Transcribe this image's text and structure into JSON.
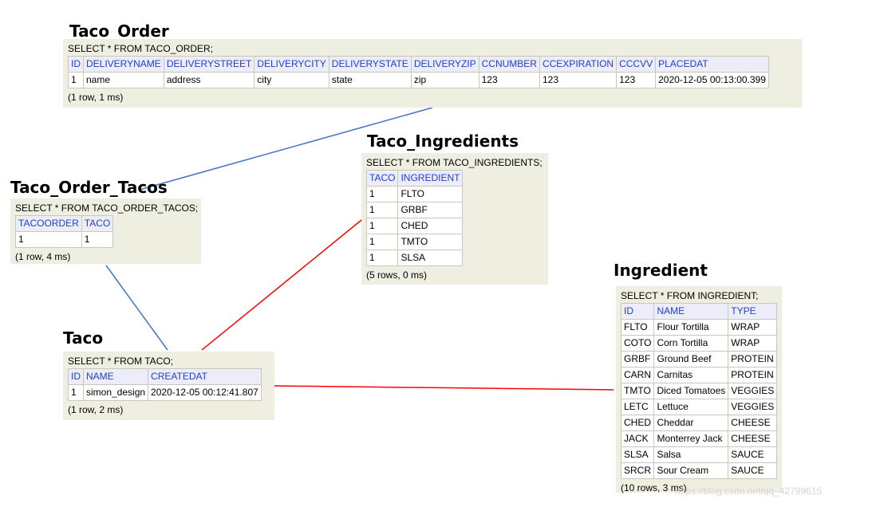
{
  "panels": {
    "taco_order": {
      "title": "Taco_Order",
      "query": "SELECT * FROM TACO_ORDER;",
      "columns": [
        "ID",
        "DELIVERYNAME",
        "DELIVERYSTREET",
        "DELIVERYCITY",
        "DELIVERYSTATE",
        "DELIVERYZIP",
        "CCNUMBER",
        "CCEXPIRATION",
        "CCCVV",
        "PLACEDAT"
      ],
      "rows": [
        [
          "1",
          "name",
          "address",
          "city",
          "state",
          "zip",
          "123",
          "123",
          "123",
          "2020-12-05 00:13:00.399"
        ]
      ],
      "footer": "(1 row, 1 ms)"
    },
    "taco_order_tacos": {
      "title": "Taco_Order_Tacos",
      "query": "SELECT * FROM TACO_ORDER_TACOS;",
      "columns": [
        "TACOORDER",
        "TACO"
      ],
      "rows": [
        [
          "1",
          "1"
        ]
      ],
      "footer": "(1 row, 4 ms)"
    },
    "taco_ingredients": {
      "title": "Taco_Ingredients",
      "query": "SELECT * FROM TACO_INGREDIENTS;",
      "columns": [
        "TACO",
        "INGREDIENT"
      ],
      "rows": [
        [
          "1",
          "FLTO"
        ],
        [
          "1",
          "GRBF"
        ],
        [
          "1",
          "CHED"
        ],
        [
          "1",
          "TMTO"
        ],
        [
          "1",
          "SLSA"
        ]
      ],
      "footer": "(5 rows, 0 ms)"
    },
    "taco": {
      "title": "Taco",
      "query": "SELECT * FROM TACO;",
      "columns": [
        "ID",
        "NAME",
        "CREATEDAT"
      ],
      "rows": [
        [
          "1",
          "simon_design",
          "2020-12-05 00:12:41.807"
        ]
      ],
      "footer": "(1 row, 2 ms)"
    },
    "ingredient": {
      "title": "Ingredient",
      "query": "SELECT * FROM INGREDIENT;",
      "columns": [
        "ID",
        "NAME",
        "TYPE"
      ],
      "rows": [
        [
          "FLTO",
          "Flour Tortilla",
          "WRAP"
        ],
        [
          "COTO",
          "Corn Tortilla",
          "WRAP"
        ],
        [
          "GRBF",
          "Ground Beef",
          "PROTEIN"
        ],
        [
          "CARN",
          "Carnitas",
          "PROTEIN"
        ],
        [
          "TMTO",
          "Diced Tomatoes",
          "VEGGIES"
        ],
        [
          "LETC",
          "Lettuce",
          "VEGGIES"
        ],
        [
          "CHED",
          "Cheddar",
          "CHEESE"
        ],
        [
          "JACK",
          "Monterrey Jack",
          "CHEESE"
        ],
        [
          "SLSA",
          "Salsa",
          "SAUCE"
        ],
        [
          "SRCR",
          "Sour Cream",
          "SAUCE"
        ]
      ],
      "footer": "(10 rows, 3 ms)"
    }
  },
  "connectors": {
    "blue_color": "#4472c4",
    "red_color": "#ff0000"
  },
  "watermark": "https://blog.csdn.net/qq_42799615"
}
